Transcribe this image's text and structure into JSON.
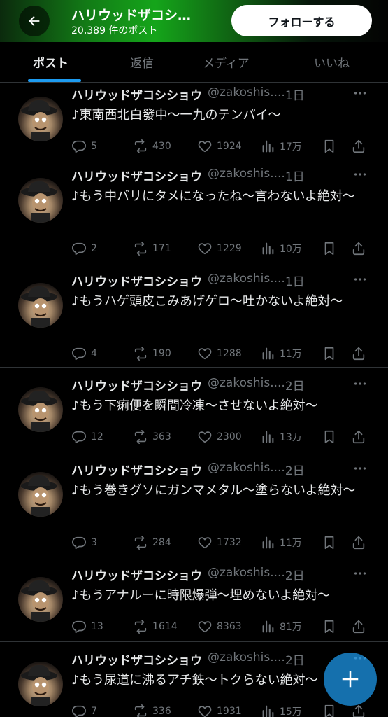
{
  "header": {
    "title": "ハリウッドザコシ…",
    "post_count": "20,389 件のポスト",
    "follow_label": "フォローする",
    "gradient_colors": [
      "#0b2a0d",
      "#15a51a",
      "#030303"
    ]
  },
  "tabs": [
    {
      "label": "ポスト",
      "active": true
    },
    {
      "label": "返信",
      "active": false
    },
    {
      "label": "メディア",
      "active": false
    },
    {
      "label": "いいね",
      "active": false
    }
  ],
  "accent_color": "#1d9bf0",
  "posts": [
    {
      "name": "ハリウッドザコシショウ",
      "handle": "@zakoshis...",
      "dot": "·",
      "time": "1日",
      "text": "♪東南西北白發中〜一九のテンパイ〜",
      "replies": "5",
      "reposts": "430",
      "likes": "1924",
      "views": "17万"
    },
    {
      "name": "ハリウッドザコシショウ",
      "handle": "@zakoshis...",
      "dot": "·",
      "time": "1日",
      "text": "♪もう中バリにタメになったね〜言わないよ絶対〜",
      "replies": "2",
      "reposts": "171",
      "likes": "1229",
      "views": "10万"
    },
    {
      "name": "ハリウッドザコシショウ",
      "handle": "@zakoshis...",
      "dot": "·",
      "time": "1日",
      "text": "♪もうハゲ頭皮こみあげゲロ〜吐かないよ絶対〜",
      "replies": "4",
      "reposts": "190",
      "likes": "1288",
      "views": "11万"
    },
    {
      "name": "ハリウッドザコシショウ",
      "handle": "@zakoshis...",
      "dot": "·",
      "time": "2日",
      "text": "♪もう下痢便を瞬間冷凍〜させないよ絶対〜",
      "replies": "12",
      "reposts": "363",
      "likes": "2300",
      "views": "13万"
    },
    {
      "name": "ハリウッドザコシショウ",
      "handle": "@zakoshis...",
      "dot": "·",
      "time": "2日",
      "text": "♪もう巻きグソにガンマメタル〜塗らないよ絶対〜",
      "replies": "3",
      "reposts": "284",
      "likes": "1732",
      "views": "11万"
    },
    {
      "name": "ハリウッドザコシショウ",
      "handle": "@zakoshis...",
      "dot": "·",
      "time": "2日",
      "text": "♪もうアナルーに時限爆弾〜埋めないよ絶対〜",
      "replies": "13",
      "reposts": "1614",
      "likes": "8363",
      "views": "81万"
    },
    {
      "name": "ハリウッドザコシショウ",
      "handle": "@zakoshis...",
      "dot": "·",
      "time": "2日",
      "text": "♪もう尿道に沸るアチ鉄〜トクらない絶対〜",
      "replies": "7",
      "reposts": "336",
      "likes": "1931",
      "views": "15万"
    }
  ],
  "icons": {
    "back": "arrow-left-icon",
    "reply": "reply-icon",
    "repost": "repost-icon",
    "like": "heart-icon",
    "views": "views-icon",
    "bookmark": "bookmark-icon",
    "share": "share-icon",
    "more": "more-icon",
    "compose": "plus-icon"
  }
}
